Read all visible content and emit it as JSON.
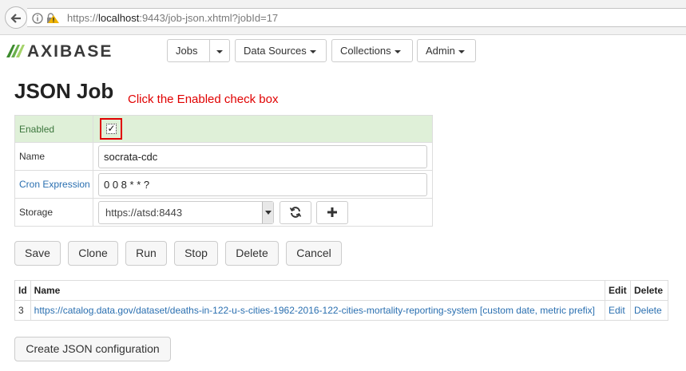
{
  "browser": {
    "url_prefix": "https://",
    "url_host": "localhost",
    "url_rest": ":9443/job-json.xhtml?jobId=17"
  },
  "brand": "AXIBASE",
  "nav": {
    "jobs": "Jobs",
    "data_sources": "Data Sources",
    "collections": "Collections",
    "admin": "Admin"
  },
  "page": {
    "title": "JSON Job",
    "hint": "Click the Enabled check box"
  },
  "form": {
    "enabled_label": "Enabled",
    "enabled_checked": true,
    "name_label": "Name",
    "name_value": "socrata-cdc",
    "cron_label": "Cron Expression",
    "cron_value": "0 0 8 * * ?",
    "storage_label": "Storage",
    "storage_value": "https://atsd:8443"
  },
  "actions": {
    "save": "Save",
    "clone": "Clone",
    "run": "Run",
    "stop": "Stop",
    "delete": "Delete",
    "cancel": "Cancel"
  },
  "jobs_table": {
    "headers": {
      "id": "Id",
      "name": "Name",
      "edit": "Edit",
      "delete": "Delete"
    },
    "rows": [
      {
        "id": "3",
        "name": "https://catalog.data.gov/dataset/deaths-in-122-u-s-cities-1962-2016-122-cities-mortality-reporting-system [custom date, metric prefix]",
        "edit": "Edit",
        "delete": "Delete"
      }
    ]
  },
  "create_button": "Create JSON configuration"
}
